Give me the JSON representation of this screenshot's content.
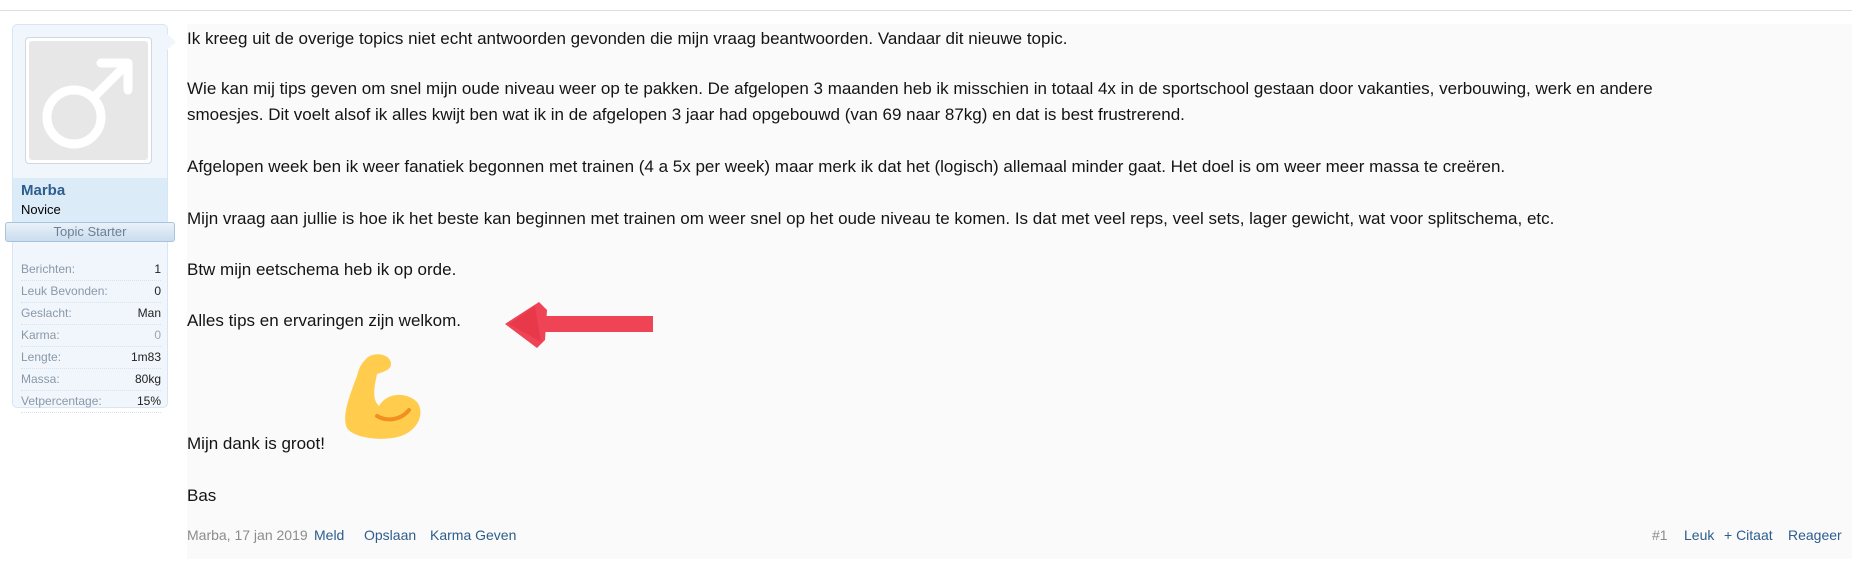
{
  "post": {
    "paragraphs": [
      [
        "Ik kreeg uit de overige topics niet echt antwoorden gevonden die mijn vraag beantwoorden. Vandaar dit nieuwe topic."
      ],
      [
        "Wie kan mij tips geven om snel mijn oude niveau weer op te pakken. De afgelopen 3 maanden heb ik misschien in totaal 4x in de sportschool gestaan door vakanties, verbouwing, werk en andere",
        "smoesjes. Dit voelt alsof ik alles kwijt ben wat ik in de afgelopen 3 jaar had opgebouwd (van 69 naar 87kg) en dat is best frustrerend."
      ],
      [
        "Afgelopen week ben ik weer fanatiek begonnen met trainen (4 a 5x per week) maar merk ik dat het (logisch) allemaal minder gaat. Het doel is om weer meer massa te creëren."
      ],
      [
        "Mijn vraag aan jullie is hoe ik het beste kan beginnen met trainen om weer snel op het oude niveau te komen. Is dat met veel reps, veel sets, lager gewicht, wat voor splitschema, etc."
      ],
      [
        "Btw mijn eetschema heb ik op orde."
      ],
      [
        "Alles tips en ervaringen zijn welkom."
      ],
      [
        "Mijn dank is groot!"
      ],
      [
        "Bas"
      ]
    ],
    "footer": {
      "author_date": "Marba, 17 jan 2019",
      "report": "Meld",
      "save": "Opslaan",
      "karma": "Karma Geven",
      "post_number": "#1",
      "like": "Leuk",
      "quote": "+ Citaat",
      "reply": "Reageer"
    }
  },
  "user": {
    "name": "Marba",
    "title": "Novice",
    "badge": "Topic Starter",
    "avatar_icon": "male-symbol-icon",
    "stats": [
      {
        "key": "Berichten:",
        "value": "1"
      },
      {
        "key": "Leuk Bevonden:",
        "value": "0"
      },
      {
        "key": "Geslacht:",
        "value": "Man"
      },
      {
        "key": "Karma:",
        "value": "0"
      },
      {
        "key": "Lengte:",
        "value": "1m83"
      },
      {
        "key": "Massa:",
        "value": "80kg"
      },
      {
        "key": "Vetpercentage:",
        "value": "15%"
      }
    ]
  },
  "colors": {
    "link": "#2e5d8e",
    "username": "#2d5e8e",
    "panel_bg": "#f0f6fc",
    "arrow_red": "#ee4455",
    "emoji_yellow": "#ffcc4d"
  }
}
